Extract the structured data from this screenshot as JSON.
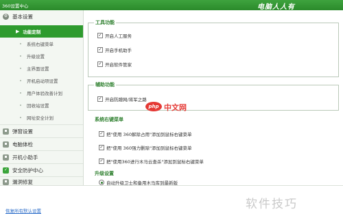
{
  "window": {
    "title": "360设置中心",
    "brand": "电脑人人有"
  },
  "sidebar": {
    "sections": [
      {
        "label": "基本设置",
        "icon": "gear-icon"
      },
      {
        "label": "弹窗设置",
        "icon": "popup-icon"
      },
      {
        "label": "电脑体检",
        "icon": "checkup-icon"
      },
      {
        "label": "开机小助手",
        "icon": "startup-icon"
      },
      {
        "label": "安全防护中心",
        "icon": "shield-icon"
      },
      {
        "label": "漏洞修复",
        "icon": "patch-icon"
      }
    ],
    "items": [
      {
        "label": "功能定制",
        "active": true
      },
      {
        "label": "系统右键菜单"
      },
      {
        "label": "升级设置"
      },
      {
        "label": "主界面设置"
      },
      {
        "label": "开机启动项设置"
      },
      {
        "label": "用户体验改善计划"
      },
      {
        "label": "回收站设置"
      },
      {
        "label": "网址安全计划"
      }
    ]
  },
  "main": {
    "tool_functions": {
      "title": "工具功能",
      "options": [
        {
          "label": "开启人工服务",
          "checked": true
        },
        {
          "label": "开启手机助手",
          "checked": true
        },
        {
          "label": "开启软件管家",
          "checked": true
        }
      ]
    },
    "aux_functions": {
      "title": "辅助功能",
      "options": [
        {
          "label": "开启防蹭网/将军之路",
          "checked": true
        }
      ]
    },
    "context_menu": {
      "title": "系统右键菜单",
      "options": [
        {
          "label": "把\"使用 360解除占用\"添加到鼠标右键菜单",
          "checked": true
        },
        {
          "label": "把\"使用 360强力删除\"添加到鼠标右键菜单",
          "checked": true
        },
        {
          "label": "把\"使用360进行木马云查杀\"添加到鼠标右键菜单",
          "checked": true
        }
      ]
    },
    "upgrade": {
      "title": "升级设置",
      "options": [
        {
          "label": "自动升级卫士和备用木马库到最新版",
          "selected": true
        }
      ]
    }
  },
  "footer": {
    "reset_label": "恢复所有默认设置"
  },
  "watermark": {
    "php": "php",
    "cn": "中文网",
    "corner": "软件技巧"
  },
  "colors": {
    "accent": "#2e9b2e",
    "titlebar": "#3ea33e",
    "section_title": "#2a7d2a",
    "link": "#2a6cc9"
  }
}
